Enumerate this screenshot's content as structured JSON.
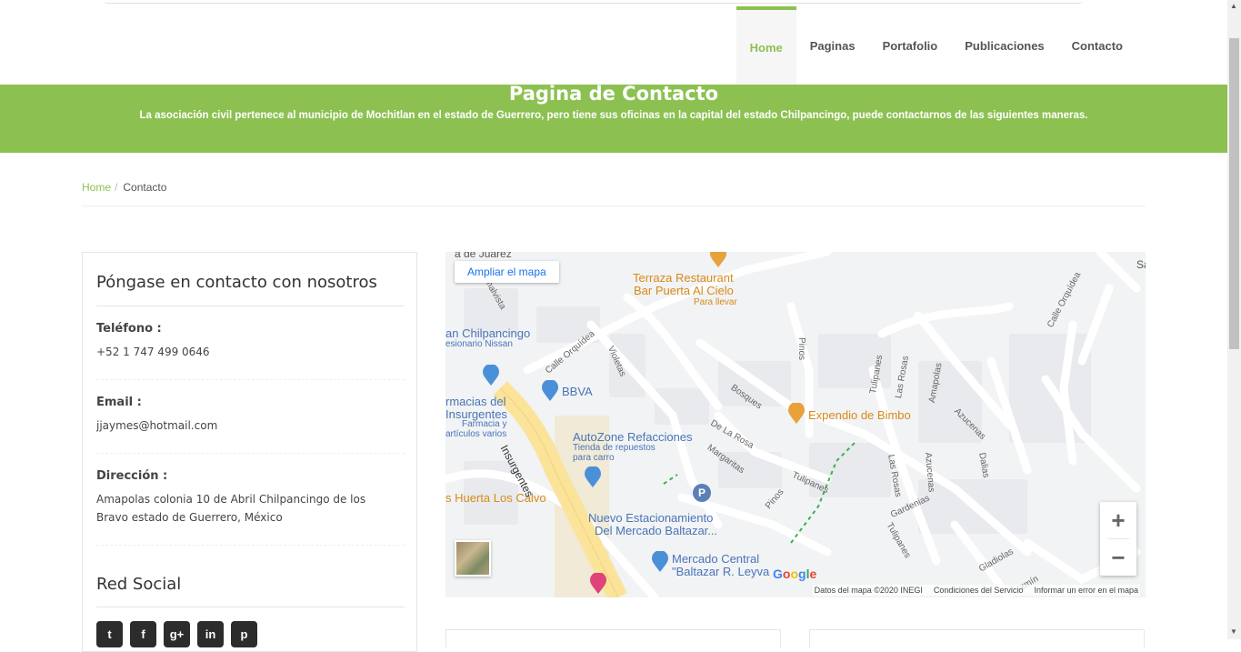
{
  "nav": {
    "items": [
      "Home",
      "Paginas",
      "Portafolio",
      "Publicaciones",
      "Contacto"
    ],
    "active": "Home"
  },
  "hero": {
    "title": "Pagina de Contacto",
    "subtitle": "La asociación civil pertenece al municipio de Mochitlan en el estado de Guerrero, pero tiene sus oficinas en la capital del estado Chilpancingo, puede contactarnos de las siguientes maneras."
  },
  "breadcrumb": {
    "home": "Home",
    "separator": "/",
    "current": "Contacto"
  },
  "contact": {
    "title": "Póngase en contacto con nosotros",
    "phone_label": "Teléfono :",
    "phone": "+52 1 747 499 0646",
    "email_label": "Email :",
    "email": "jjaymes@hotmail.com",
    "address_label": "Dirección :",
    "address": "Amapolas colonia 10 de Abril Chilpancingo de los Bravo estado de Guerrero, México",
    "social_title": "Red Social",
    "social_icons": [
      "twitter-icon",
      "facebook-icon",
      "google-plus-icon",
      "linkedin-icon",
      "pinterest-icon"
    ],
    "social_glyphs": [
      "t",
      "f",
      "g+",
      "in",
      "p"
    ]
  },
  "map": {
    "enlarge": "Ampliar el mapa",
    "labels": {
      "juarez": "a de Juárez",
      "terraza": "Terraza Restaurant",
      "bar": "Bar Puerta Al Cielo",
      "parallevar": "Para llevar",
      "chilpancingo": "an Chilpancingo",
      "nissan": "esionario Nissan",
      "bbva": "BBVA",
      "farmacias": "rmacias del",
      "insurgentes_store": "Insurgentes",
      "farmacia": "Farmacia y",
      "articulos": "artículos varios",
      "autozone": "AutoZone Refacciones",
      "tienda": "Tienda de repuestos",
      "paracarro": "para carro",
      "expendio": "Expendio de Bimbo",
      "huerta": "s Huerta Los Calvo",
      "estacionamiento": "Nuevo Estacionamiento",
      "delmercado": "Del Mercado Baltazar...",
      "mercado": "Mercado Central",
      "baltazar": "\"Baltazar R. Leyva",
      "insurgentes_road": "Insurgentes",
      "orquidea": "Calle Orquídea",
      "orquidea2": "Calle Orquídea",
      "violetas": "Violetas",
      "pinos": "Pinos",
      "pinos2": "Pinos",
      "bosques": "Bosques",
      "delarosa": "De La Rosa",
      "margaritas": "Margaritas",
      "tulipanes": "Tulipanes",
      "tulipanes2": "Tulipanes",
      "tulipanes3": "Tulipanes",
      "lasrosas": "Las Rosas",
      "lasrosas2": "Las Rosas",
      "amapolas": "Amapolas",
      "azucenas": "Azucenas",
      "azucenas2": "Azucenas",
      "dalias": "Dalias",
      "gardenias": "Gardenias",
      "gladiolas": "Gladiolas",
      "jazmin": "zmín",
      "malvista": "malvista",
      "sa": "Sa",
      "parking": "P"
    },
    "google": [
      "G",
      "o",
      "o",
      "g",
      "l",
      "e"
    ],
    "attribution": [
      "Datos del mapa ©2020 INEGI",
      "Condiciones del Servicio",
      "Informar un error en el mapa"
    ],
    "zoom_in": "+",
    "zoom_out": "−"
  },
  "colors": {
    "accent": "#8cc152",
    "poi_orange": "#e8a13b",
    "poi_blue": "#4a90d9",
    "road_yellow": "#fbe39a",
    "hotel_pink": "#e0427a"
  }
}
